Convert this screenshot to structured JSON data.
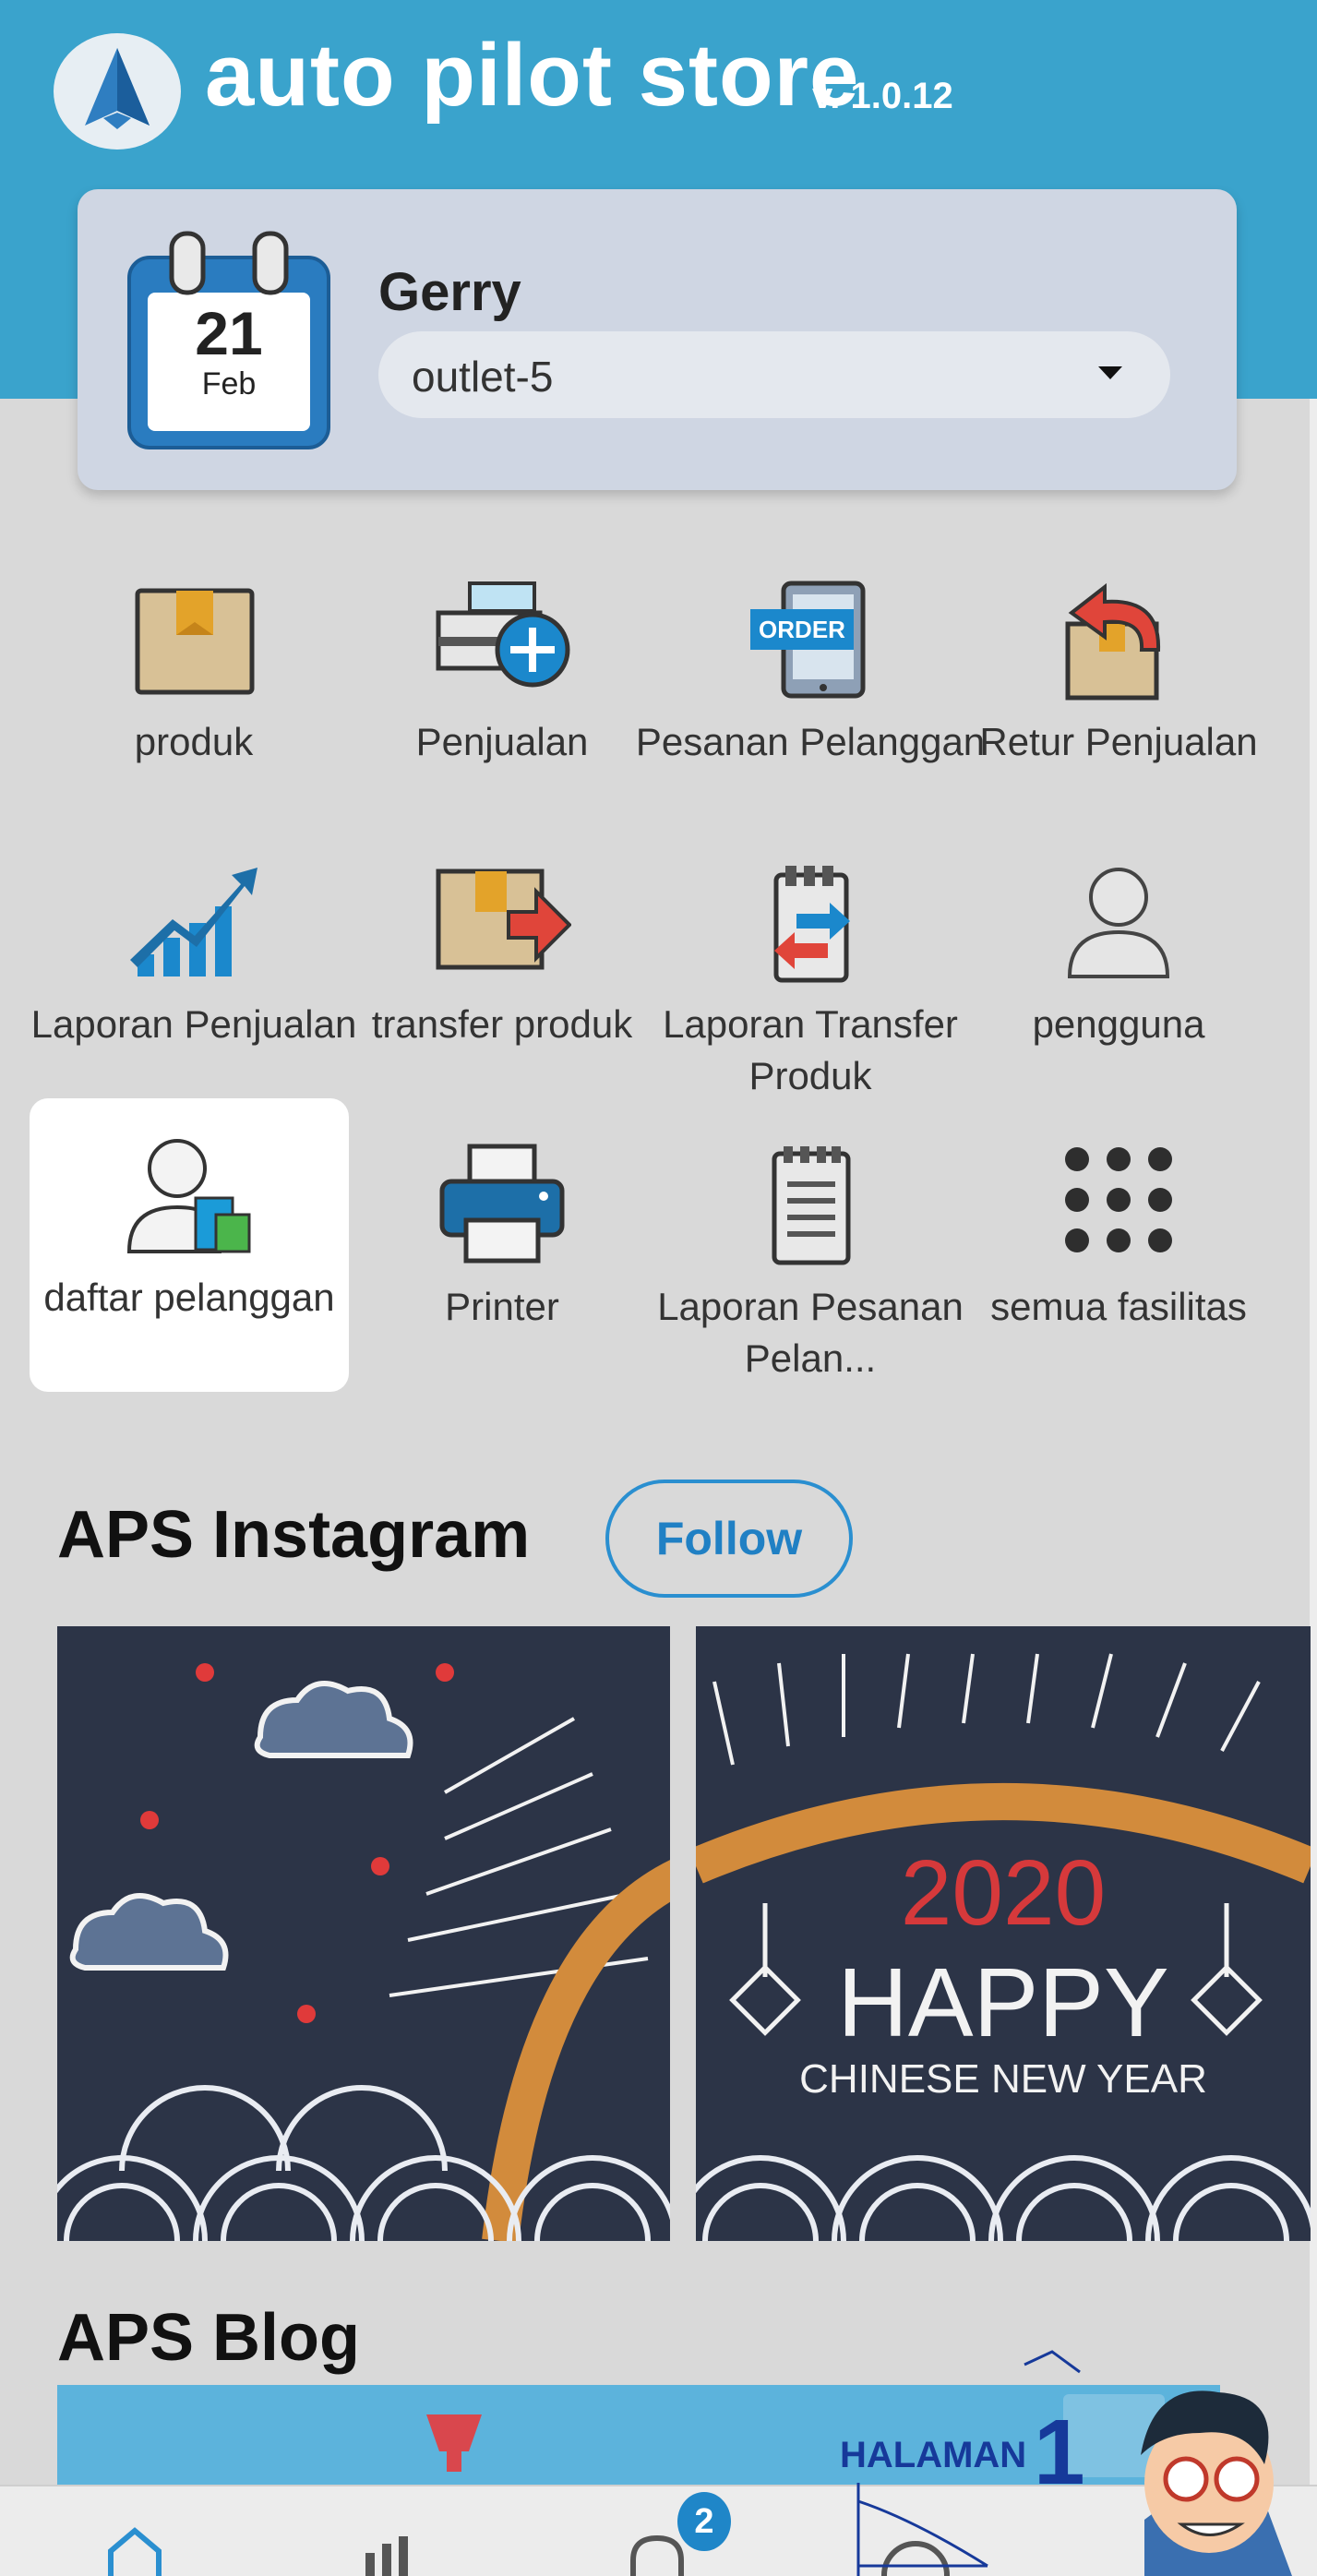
{
  "header": {
    "app_title": "auto pilot store",
    "version": "v. 1.0.12"
  },
  "user_card": {
    "calendar_day": "21",
    "calendar_month": "Feb",
    "user_name": "Gerry",
    "outlet_selected": "outlet-5"
  },
  "menu": {
    "items": [
      {
        "label": "produk",
        "icon": "box-icon"
      },
      {
        "label": "Penjualan",
        "icon": "cash-register-add-icon"
      },
      {
        "label": "Pesanan Pelanggan",
        "icon": "tablet-order-icon"
      },
      {
        "label": "Retur Penjualan",
        "icon": "box-return-icon"
      },
      {
        "label": "Laporan Penjualan",
        "icon": "growth-chart-icon"
      },
      {
        "label": "transfer produk",
        "icon": "box-transfer-icon"
      },
      {
        "label": "Laporan Transfer Produk",
        "icon": "clipboard-transfer-icon"
      },
      {
        "label": "pengguna",
        "icon": "user-icon"
      },
      {
        "label": "daftar pelanggan",
        "icon": "customer-shopping-icon"
      },
      {
        "label": "Printer",
        "icon": "printer-icon"
      },
      {
        "label": "Laporan Pesanan Pelan...",
        "icon": "notepad-icon"
      },
      {
        "label": "semua fasilitas",
        "icon": "grid-dots-icon"
      }
    ]
  },
  "instagram": {
    "title": "APS Instagram",
    "follow_label": "Follow",
    "posts": [
      {
        "lines": []
      },
      {
        "year": "2020",
        "line1": "HAPPY",
        "line2": "CHINESE NEW YEAR"
      }
    ]
  },
  "blog": {
    "title": "APS Blog"
  },
  "bottom_nav": {
    "notification_count": "2"
  },
  "watermark": {
    "text": "HALAMAN",
    "number": "1"
  },
  "colors": {
    "header": "#3aa3cc",
    "accent": "#1f86c8",
    "background": "#d9d9d9"
  }
}
